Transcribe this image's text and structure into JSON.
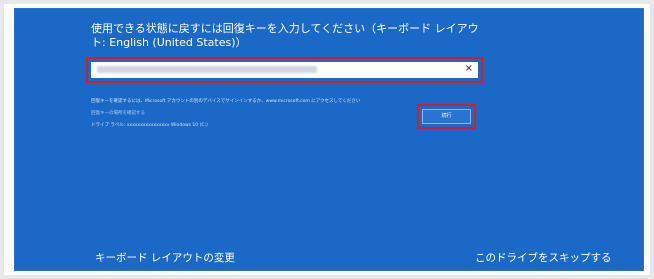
{
  "dialog": {
    "title": "使用できる状態に戻すには回復キーを入力してください（キーボード レイアウト: English (United States)）",
    "key_input": {
      "value_obscured": true,
      "clear_icon": "×"
    },
    "help_lines": [
      "回復キーを確認するには、Microsoft アカウントの別のデバイスでサインインするか、www.microsoft.com にアクセスしてください",
      "回復キーの場所を確認する",
      "ドライブ ラベル: xxxxxxxxxxxxxxxx Windows 10 (C:)"
    ],
    "help_link_text": "回復キーの場所を確認する",
    "next_button_label": "続行",
    "change_keyboard_layout_label": "キーボード レイアウトの変更",
    "skip_drive_label": "このドライブをスキップする"
  },
  "colors": {
    "panel_blue": "#1b68c7",
    "highlight_red": "#d21d2d"
  }
}
